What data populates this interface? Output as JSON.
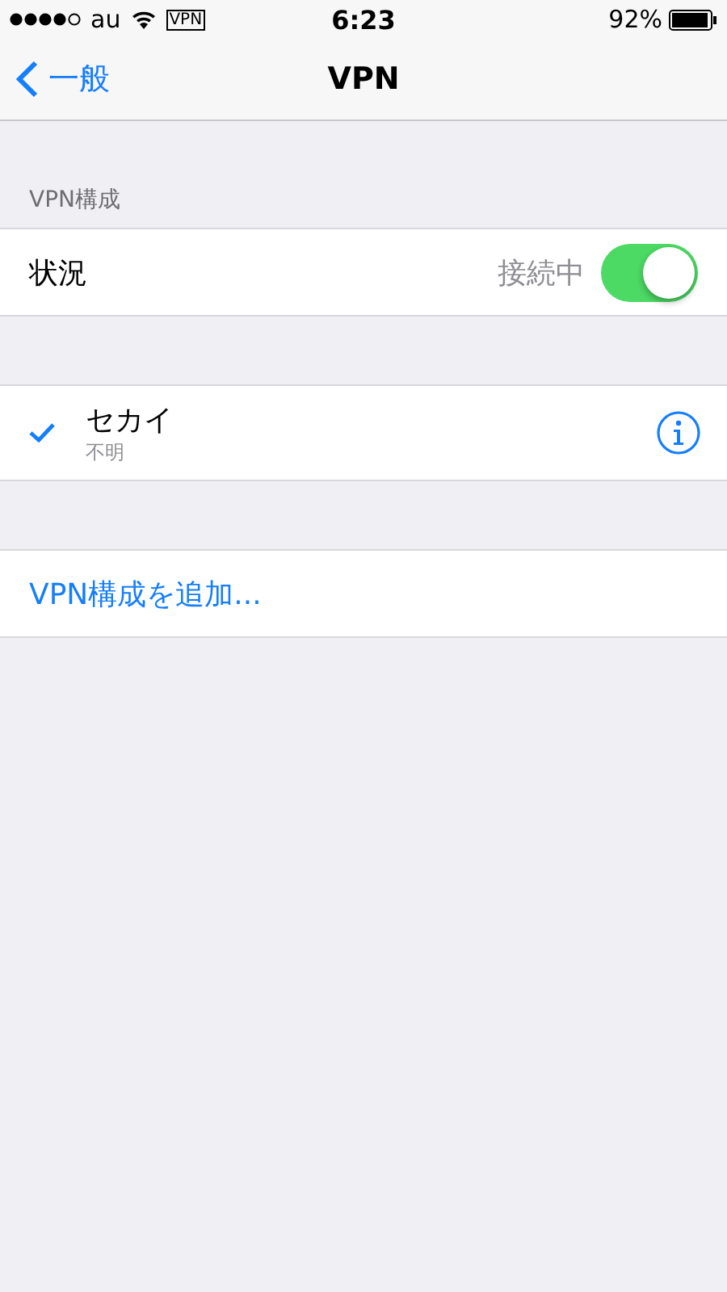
{
  "status_bar": {
    "carrier": "au",
    "vpn": "VPN",
    "time": "6:23",
    "battery": "92%"
  },
  "nav": {
    "back": "一般",
    "title": "VPN"
  },
  "section_header": "VPN構成",
  "status_row": {
    "label": "状況",
    "value": "接続中",
    "on": true
  },
  "configs": [
    {
      "name": "セカイ",
      "status": "不明",
      "selected": true
    }
  ],
  "add_link": "VPN構成を追加..."
}
